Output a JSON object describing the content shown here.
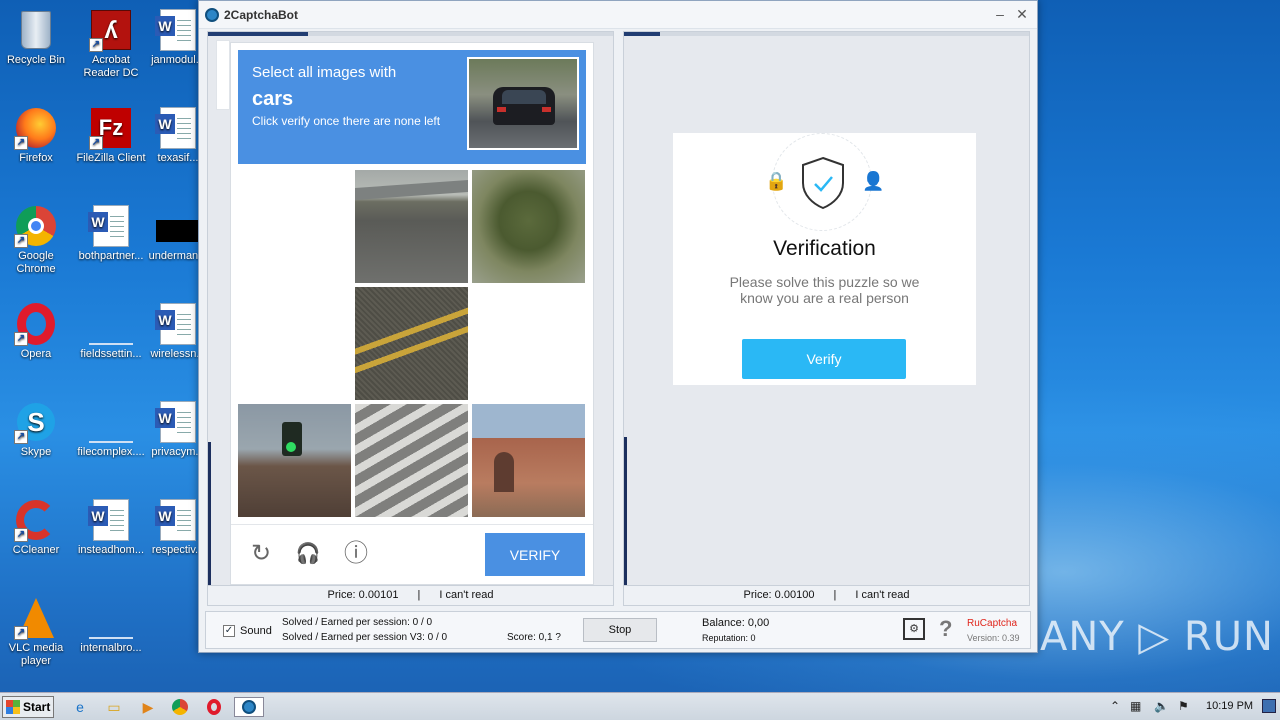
{
  "desktop": {
    "icons": [
      {
        "label": "Recycle Bin"
      },
      {
        "label": "Acrobat Reader DC"
      },
      {
        "label": "janmodul..."
      },
      {
        "label": "Firefox"
      },
      {
        "label": "FileZilla Client"
      },
      {
        "label": "texasif..."
      },
      {
        "label": "Google Chrome"
      },
      {
        "label": "bothpartner..."
      },
      {
        "label": "underman..."
      },
      {
        "label": "Opera"
      },
      {
        "label": "fieldssettin..."
      },
      {
        "label": "wirelessn..."
      },
      {
        "label": "Skype"
      },
      {
        "label": "filecomplex...."
      },
      {
        "label": "privacym..."
      },
      {
        "label": "CCleaner"
      },
      {
        "label": "insteadhom..."
      },
      {
        "label": "respectiv..."
      },
      {
        "label": "VLC media player"
      },
      {
        "label": "internalbro..."
      }
    ]
  },
  "window": {
    "title": "2CaptchaBot",
    "minimize": "–",
    "close": "✕"
  },
  "left_pane": {
    "captcha": {
      "line1": "Select all images with",
      "target": "cars",
      "line3": "Click verify once there are none left",
      "verify_label": "VERIFY",
      "tools": {
        "refresh": "↻",
        "audio": "🎧",
        "info": "ⓘ"
      }
    },
    "footer": {
      "price": "Price: 0.00101",
      "sep": "|",
      "cant_read": "I can't read"
    }
  },
  "right_pane": {
    "card": {
      "title": "Verification",
      "subtitle": "Please solve this puzzle so we know you are a real person",
      "button": "Verify",
      "icons": {
        "lock": "🔒",
        "user": "👤"
      }
    },
    "footer": {
      "price": "Price: 0.00100",
      "sep": "|",
      "cant_read": "I can't read"
    }
  },
  "status": {
    "sound_checked": "✓",
    "sound_label": "Sound",
    "solved": "Solved / Earned per session: 0 / 0",
    "solved_v3": "Solved / Earned per session V3: 0 / 0",
    "score": "Score: 0,1 ?",
    "stop": "Stop",
    "balance": "Balance:  0,00",
    "reputation": "Reputation: 0",
    "settings_glyph": "⚙",
    "help_glyph": "?",
    "provider": "RuCaptcha",
    "version": "Version: 0.39"
  },
  "watermark": "ANY ▷ RUN",
  "taskbar": {
    "start": "Start",
    "clock": "10:19 PM",
    "tray_up": "⌃",
    "tray_flag": "⚑"
  },
  "colors": {
    "captcha_blue": "#4a90e2",
    "verify_cyan": "#2ab8f5",
    "provider_red": "#e0261c",
    "pane_progress": "#213d72"
  }
}
